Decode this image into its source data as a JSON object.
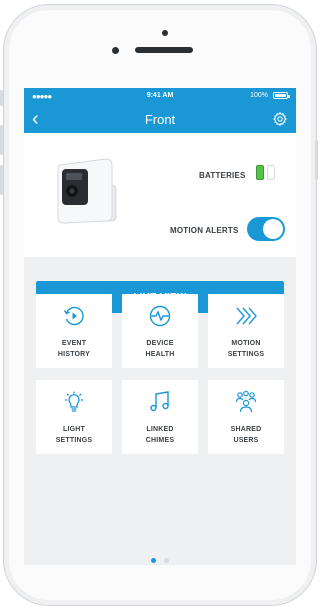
{
  "status_bar": {
    "signal": "●●●●●",
    "time": "9:41 AM",
    "battery_percent": "100%"
  },
  "nav": {
    "back_icon": "chevron-left-icon",
    "back_glyph": "‹",
    "title": "Front",
    "settings_icon": "gear-icon"
  },
  "device": {
    "batteries_label": "BATTERIES",
    "battery_cells": [
      "full",
      "empty"
    ],
    "motion_alerts_label": "MOTION ALERTS",
    "motion_alerts_on": true
  },
  "live_view": {
    "label": "LIVE VIEW"
  },
  "tiles": [
    {
      "line1": "EVENT",
      "line2": "HISTORY",
      "icon": "history-icon"
    },
    {
      "line1": "DEVICE",
      "line2": "HEALTH",
      "icon": "pulse-icon"
    },
    {
      "line1": "MOTION",
      "line2": "SETTINGS",
      "icon": "chevrons-right-icon"
    },
    {
      "line1": "LIGHT",
      "line2": "SETTINGS",
      "icon": "lightbulb-icon"
    },
    {
      "line1": "LINKED",
      "line2": "CHIMES",
      "icon": "music-note-icon"
    },
    {
      "line1": "SHARED",
      "line2": "USERS",
      "icon": "users-icon"
    }
  ],
  "page_indicator": {
    "count": 2,
    "active": 0
  },
  "colors": {
    "accent": "#1998d5",
    "battery_green": "#55c349",
    "background": "#eef0f2",
    "text": "#3a3f44"
  }
}
